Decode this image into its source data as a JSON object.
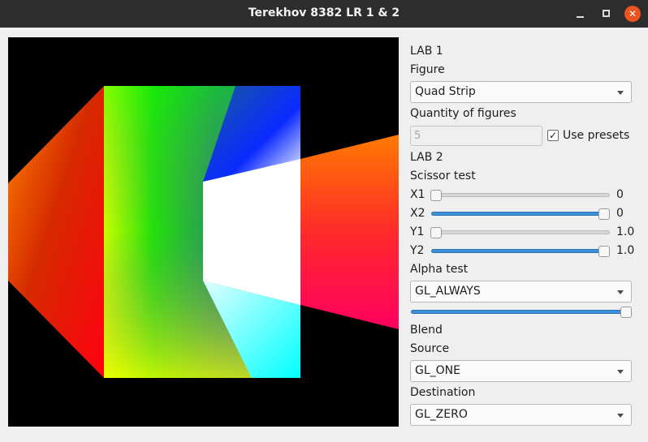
{
  "window": {
    "title": "Terekhov 8382 LR 1 & 2",
    "close_glyph": "✕"
  },
  "lab1": {
    "heading": "LAB 1",
    "figure_label": "Figure",
    "figure_value": "Quad Strip",
    "quantity_label": "Quantity of figures",
    "quantity_value": "5",
    "use_presets_label": "Use presets",
    "use_presets_checked": "✓"
  },
  "lab2": {
    "heading": "LAB 2",
    "scissor_label": "Scissor test",
    "x1": {
      "label": "X1",
      "value": "0",
      "fraction": 0.0
    },
    "x2": {
      "label": "X2",
      "value": "0",
      "fraction": 1.0
    },
    "y1": {
      "label": "Y1",
      "value": "1.0",
      "fraction": 0.0
    },
    "y2": {
      "label": "Y2",
      "value": "1.0",
      "fraction": 1.0
    },
    "alpha_label": "Alpha test",
    "alpha_func": "GL_ALWAYS",
    "alpha_fraction": 1.0,
    "blend_label": "Blend",
    "source_label": "Source",
    "source_value": "GL_ONE",
    "destination_label": "Destination",
    "destination_value": "GL_ZERO"
  },
  "colors": {
    "accent": "#3d8fd6",
    "titlebar": "#2d2d2d",
    "close": "#e95420"
  }
}
